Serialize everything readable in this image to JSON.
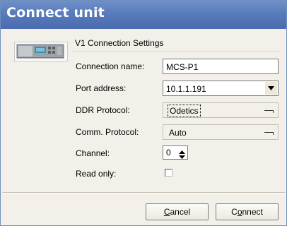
{
  "window": {
    "title": "Connect unit"
  },
  "device": {
    "icon": "rack-unit-icon"
  },
  "group": {
    "title": "V1 Connection Settings"
  },
  "fields": {
    "connection_name": {
      "label": "Connection name:",
      "value": "MCS-P1"
    },
    "port_address": {
      "label": "Port address:",
      "value": "10.1.1.191"
    },
    "ddr_protocol": {
      "label": "DDR Protocol:",
      "value": "Odetics"
    },
    "comm_protocol": {
      "label": "Comm. Protocol:",
      "value": "Auto"
    },
    "channel": {
      "label": "Channel:",
      "value": "0"
    },
    "read_only": {
      "label": "Read only:",
      "checked": false
    }
  },
  "buttons": {
    "cancel": {
      "mnemonic": "C",
      "rest": "ancel"
    },
    "connect": {
      "prefix": "C",
      "mnemonic": "o",
      "rest": "nnect"
    }
  },
  "colors": {
    "titlebar": "#587bbb",
    "dialog_bg": "#f3f0ea"
  }
}
